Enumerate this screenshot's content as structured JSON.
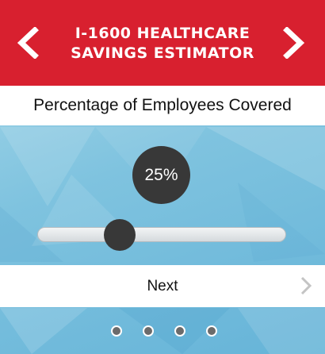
{
  "header": {
    "title": "I-1600 HEALTHCARE\nSAVINGS ESTIMATOR",
    "prev_icon": "chevron-left-icon",
    "next_icon": "chevron-right-icon",
    "color": "#d8202f"
  },
  "question": {
    "label": "Percentage of Employees Covered"
  },
  "slider": {
    "value_label": "25%",
    "value": 25,
    "min": 0,
    "max": 100
  },
  "next_bar": {
    "label": "Next",
    "icon": "chevron-right-icon"
  },
  "pagination": {
    "pages": 4,
    "dot_color": "#6b6b6b"
  }
}
